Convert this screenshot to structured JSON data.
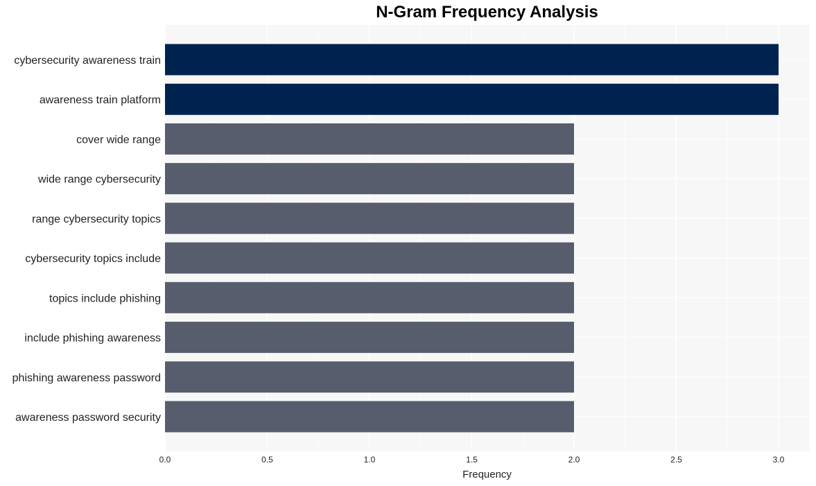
{
  "chart_data": {
    "type": "bar",
    "orientation": "horizontal",
    "title": "N-Gram Frequency Analysis",
    "xlabel": "Frequency",
    "ylabel": "",
    "xlim": [
      0,
      3.15
    ],
    "xticks": [
      "0.0",
      "0.5",
      "1.0",
      "1.5",
      "2.0",
      "2.5",
      "3.0"
    ],
    "xtick_values": [
      0,
      0.5,
      1.0,
      1.5,
      2.0,
      2.5,
      3.0
    ],
    "grid": true,
    "categories": [
      "cybersecurity awareness train",
      "awareness train platform",
      "cover wide range",
      "wide range cybersecurity",
      "range cybersecurity topics",
      "cybersecurity topics include",
      "topics include phishing",
      "include phishing awareness",
      "phishing awareness password",
      "awareness password security"
    ],
    "values": [
      3,
      3,
      2,
      2,
      2,
      2,
      2,
      2,
      2,
      2
    ],
    "colors": {
      "highlight": "#00224e",
      "default": "#575d6d",
      "plot_background": "#f7f7f7",
      "grid": "#ffffff"
    }
  }
}
